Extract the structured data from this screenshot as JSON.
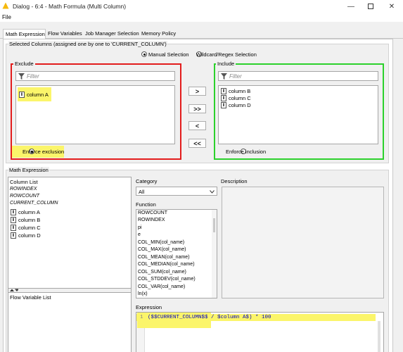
{
  "window": {
    "title": "Dialog - 6:4 - Math Formula (Multi Column)"
  },
  "menu": {
    "file": "File"
  },
  "tabs": [
    {
      "label": "Math Expression",
      "active": true
    },
    {
      "label": "Flow Variables",
      "active": false
    },
    {
      "label": "Job Manager Selection",
      "active": false
    },
    {
      "label": "Memory Policy",
      "active": false
    }
  ],
  "selected_columns": {
    "group_label": "Selected Columns (assigned one by one to 'CURRENT_COLUMN')",
    "mode_manual": "Manual Selection",
    "mode_wildcard": "Wildcard/Regex Selection",
    "mode_selected": "manual",
    "exclude": {
      "label": "Exclude",
      "filter_placeholder": "Filter",
      "items": [
        "column A"
      ],
      "enforce_label": "Enforce exclusion",
      "enforce_checked": true
    },
    "include": {
      "label": "Include",
      "filter_placeholder": "Filter",
      "items": [
        "column B",
        "column C",
        "column D"
      ],
      "enforce_label": "Enforce inclusion",
      "enforce_checked": false
    },
    "buttons": {
      "add": ">",
      "add_all": ">>",
      "remove": "<",
      "remove_all": "<<"
    }
  },
  "math_expression": {
    "group_label": "Math Expression",
    "column_list": {
      "header": "Column List",
      "specials": [
        "ROWINDEX",
        "ROWCOUNT",
        "CURRENT_COLUMN"
      ],
      "columns": [
        "column A",
        "column B",
        "column C",
        "column D"
      ]
    },
    "flow_variable_list": {
      "header": "Flow Variable List"
    },
    "category": {
      "label": "Category",
      "value": "All"
    },
    "function": {
      "label": "Function",
      "items": [
        "ROWCOUNT",
        "ROWINDEX",
        "pi",
        "e",
        "COL_MIN(col_name)",
        "COL_MAX(col_name)",
        "COL_MEAN(col_name)",
        "COL_MEDIAN(col_name)",
        "COL_SUM(col_name)",
        "COL_STDDEV(col_name)",
        "COL_VAR(col_name)",
        "ln(x)"
      ]
    },
    "description": {
      "label": "Description"
    },
    "expression": {
      "label": "Expression",
      "line_number": "1",
      "code_highlighted": "($$CURRENT_COLUMN$$",
      "code_rest": " / $column A$) * 100"
    }
  },
  "colors": {
    "exclude_border": "#e31c1c",
    "include_border": "#2cd12c",
    "highlight": "#fbf56a",
    "text_link": "#0000c0"
  }
}
